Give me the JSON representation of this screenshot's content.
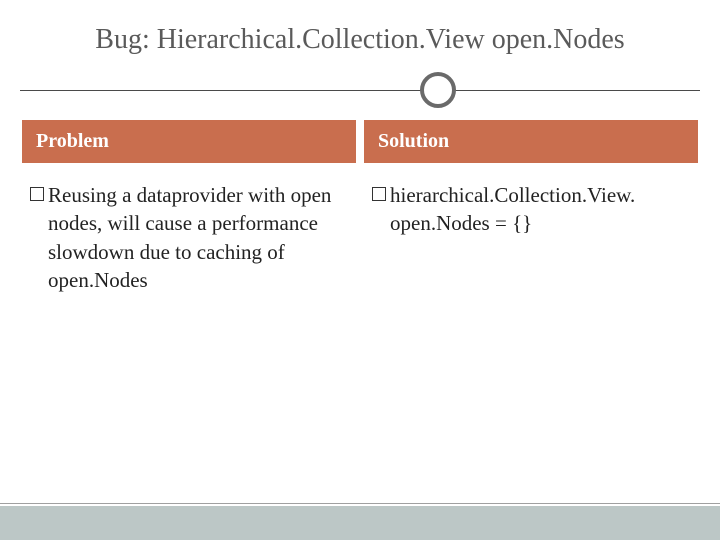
{
  "title": "Bug: Hierarchical.Collection.View open.Nodes",
  "columns": {
    "left": {
      "header": "Problem",
      "bullet": "Reusing a dataprovider with open nodes, will cause a performance slowdown due to caching of open.Nodes"
    },
    "right": {
      "header": "Solution",
      "bullet": "hierarchical.Collection.View. open.Nodes = {}"
    }
  },
  "colors": {
    "header_bg": "#c96e4e",
    "bottom_band": "#bcc7c6"
  }
}
